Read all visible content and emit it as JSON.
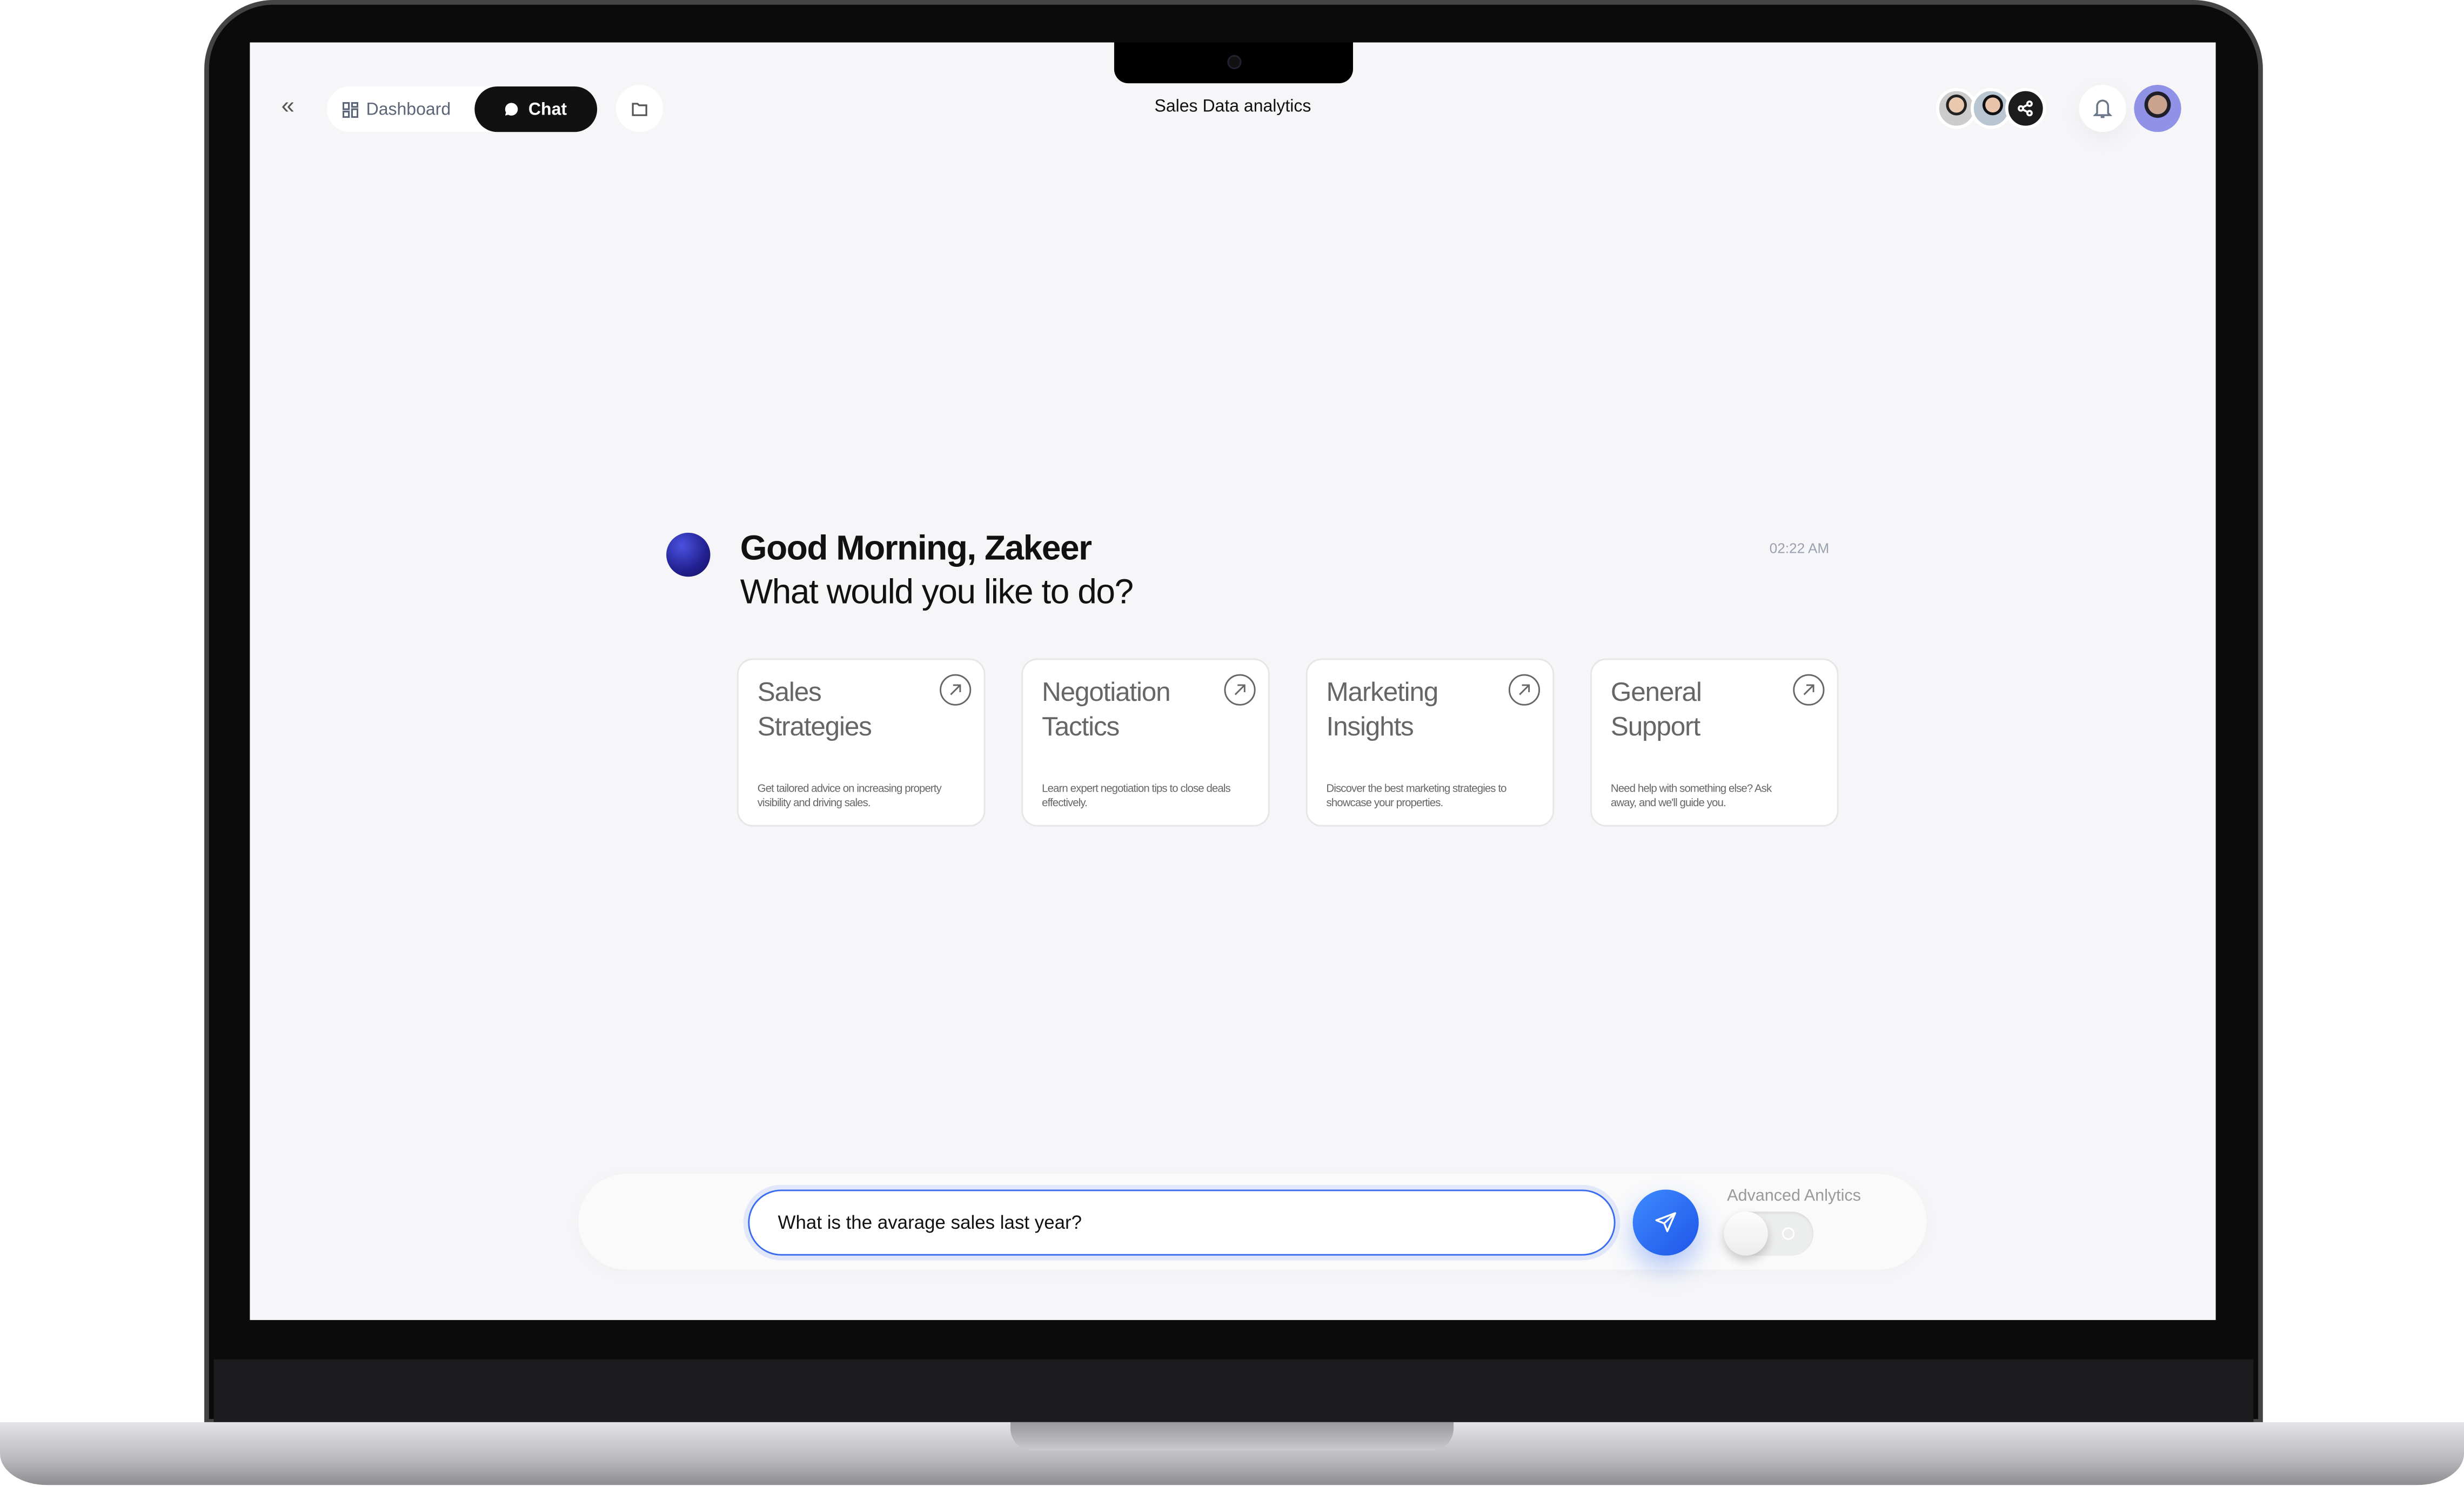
{
  "header": {
    "nav": {
      "dashboard_label": "Dashboard",
      "chat_label": "Chat"
    },
    "title": "Sales Data analytics",
    "icons": [
      "collapse-icon",
      "dashboard-grid-icon",
      "chat-bubble-icon",
      "folder-icon",
      "share-icon",
      "bell-icon"
    ]
  },
  "greeting": {
    "title": "Good Morning, Zakeer",
    "subtitle": "What would you like to do?",
    "time": "02:22 AM"
  },
  "cards": [
    {
      "title_line1": "Sales",
      "title_line2": "Strategies",
      "desc": "Get tailored advice on increasing property visibility and driving sales."
    },
    {
      "title_line1": "Negotiation",
      "title_line2": "Tactics",
      "desc": "Learn expert negotiation tips to close deals effectively."
    },
    {
      "title_line1": "Marketing",
      "title_line2": "Insights",
      "desc": "Discover the best marketing strategies to showcase your properties."
    },
    {
      "title_line1": "General",
      "title_line2": "Support",
      "desc": "Need help with something else? Ask away, and we'll guide you."
    }
  ],
  "composer": {
    "input_value": "What is the avarage sales last year?",
    "toggle_label": "Advanced Anlytics",
    "toggle_on": false
  },
  "colors": {
    "accent": "#2f6ff5",
    "background": "#f6f6f8",
    "chat_pill": "#111111",
    "orb": "#2a2aa8"
  }
}
